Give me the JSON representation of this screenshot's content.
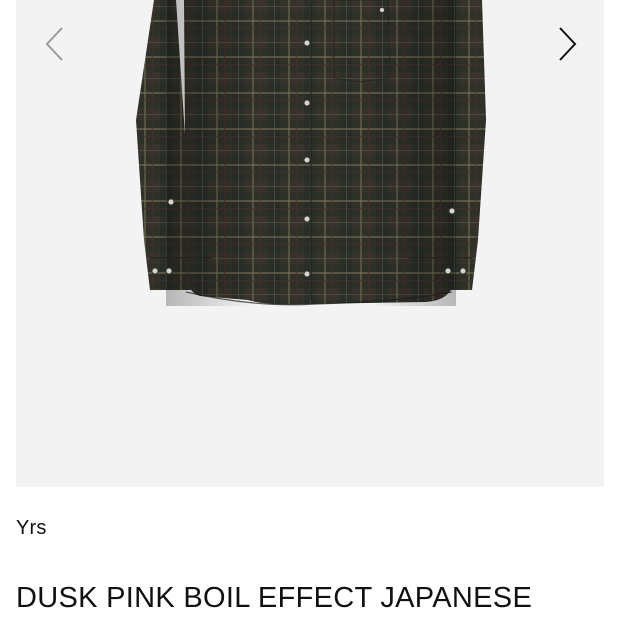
{
  "gallery": {
    "product_image": "plaid-shirt-image",
    "prev_icon": "chevron-left-icon",
    "next_icon": "chevron-right-icon"
  },
  "product": {
    "brand": "Yrs",
    "title": "DUSK PINK BOIL EFFECT JAPANESE"
  },
  "colors": {
    "background": "#ffffff",
    "gallery_background": "#f3f3f3",
    "shirt_base": "#2e3128",
    "arrow_prev": "#9a9a9a",
    "arrow_next": "#111111",
    "text": "#111111"
  }
}
